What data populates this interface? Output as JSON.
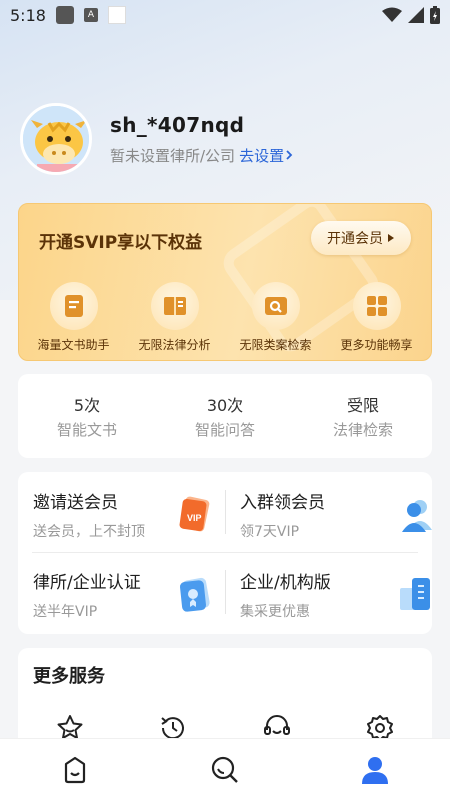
{
  "status_bar": {
    "time": "5:18",
    "a_icon_label": "A"
  },
  "profile": {
    "username": "sh_*407nqd",
    "org_text": "暂未设置律所/公司",
    "set_link": "去设置"
  },
  "svip": {
    "title": "开通SVIP享以下权益",
    "button_label": "开通会员",
    "features": [
      {
        "label": "海量文书助手",
        "icon": "document-icon"
      },
      {
        "label": "无限法律分析",
        "icon": "book-icon"
      },
      {
        "label": "无限类案检索",
        "icon": "search-doc-icon"
      },
      {
        "label": "更多功能畅享",
        "icon": "grid-icon"
      }
    ]
  },
  "stats": [
    {
      "value": "5次",
      "label": "智能文书"
    },
    {
      "value": "30次",
      "label": "智能问答"
    },
    {
      "value": "受限",
      "label": "法律检索"
    }
  ],
  "promos": [
    {
      "title": "邀请送会员",
      "subtitle": "送会员，上不封顶",
      "icon": "vip-card-icon"
    },
    {
      "title": "入群领会员",
      "subtitle": "领7天VIP",
      "icon": "group-user-icon"
    },
    {
      "title": "律所/企业认证",
      "subtitle": "送半年VIP",
      "icon": "certificate-icon"
    },
    {
      "title": "企业/机构版",
      "subtitle": "集采更优惠",
      "icon": "building-icon"
    }
  ],
  "more_services": {
    "title": "更多服务",
    "icons": [
      "star-icon",
      "history-icon",
      "customer-service-icon",
      "settings-icon"
    ]
  },
  "bottom_nav": {
    "items": [
      "home-icon",
      "search-icon",
      "profile-icon"
    ],
    "active": "profile-icon"
  },
  "colors": {
    "accent": "#2c66d8",
    "svip_text": "#5b3308",
    "svip_icon": "#e0912a",
    "nav_active": "#2f6ff0"
  }
}
